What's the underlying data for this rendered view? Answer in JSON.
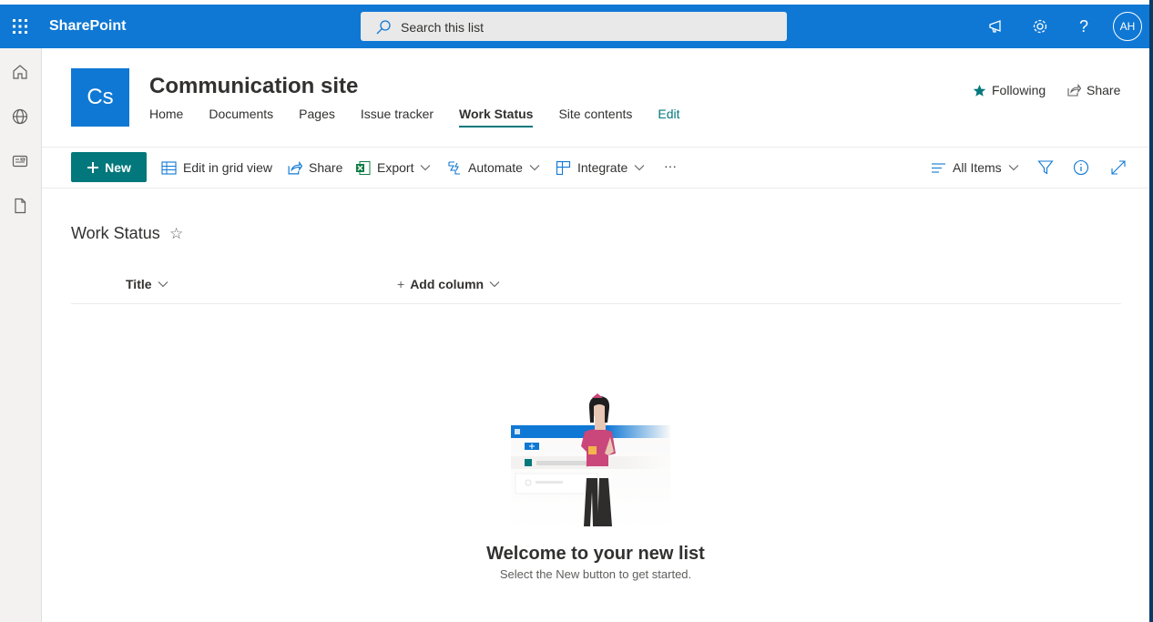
{
  "suitebar": {
    "brand": "SharePoint",
    "search_placeholder": "Search this list",
    "help_label": "?",
    "avatar_initials": "AH"
  },
  "site": {
    "logo_text": "Cs",
    "title": "Communication site",
    "nav": [
      "Home",
      "Documents",
      "Pages",
      "Issue tracker",
      "Work Status",
      "Site contents",
      "Edit"
    ],
    "following_label": "Following",
    "share_label": "Share"
  },
  "commandbar": {
    "new_label": "New",
    "edit_grid_label": "Edit in grid view",
    "share_label": "Share",
    "export_label": "Export",
    "automate_label": "Automate",
    "integrate_label": "Integrate",
    "more_label": "···",
    "view_label": "All Items"
  },
  "list": {
    "title": "Work Status",
    "favorite_icon": "☆",
    "column_title": "Title",
    "add_column": "Add column",
    "add_prefix": "+"
  },
  "empty_state": {
    "heading": "Welcome to your new list",
    "subtext": "Select the New button to get started."
  },
  "colors": {
    "suitebar": "#0f78d4",
    "accent": "#03787c",
    "rail": "#f3f2f1"
  }
}
